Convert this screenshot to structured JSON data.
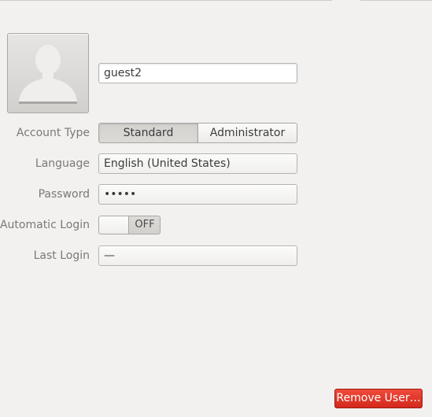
{
  "user": {
    "name_value": "guest2"
  },
  "form": {
    "account_type": {
      "label": "Account Type",
      "options": [
        "Standard",
        "Administrator"
      ],
      "selected": "Standard"
    },
    "language": {
      "label": "Language",
      "value": "English (United States)"
    },
    "password": {
      "label": "Password",
      "value": "•••••"
    },
    "automatic_login": {
      "label": "Automatic Login",
      "state_text": "OFF"
    },
    "last_login": {
      "label": "Last Login",
      "value": "—"
    }
  },
  "actions": {
    "remove_label": "Remove User…"
  },
  "colors": {
    "destructive": "#d3291c",
    "background": "#f2f1f0"
  },
  "icons": {
    "avatar": "user-silhouette-icon"
  }
}
